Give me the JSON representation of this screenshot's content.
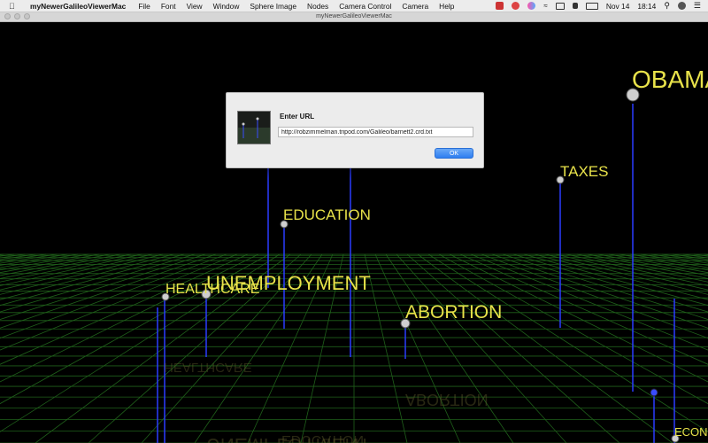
{
  "menubar": {
    "app_name": "myNewerGalileoViewerMac",
    "menus": [
      "File",
      "Font",
      "View",
      "Window",
      "Sphere Image",
      "Nodes",
      "Camera Control",
      "Camera",
      "Help"
    ],
    "date": "Nov 14",
    "time": "18:14"
  },
  "window": {
    "title": "myNewerGalileoViewerMac"
  },
  "dialog": {
    "title": "Enter URL",
    "url_value": "http://robzimmelman.tripod.com/Galileo/barnett2.crd.txt",
    "ok_label": "OK"
  },
  "scene": {
    "labels": {
      "obama": "OBAMA",
      "taxes": "TAXES",
      "education": "EDUCATION",
      "healthcare": "HEALTHCARE",
      "unemployment": "UNEMPLOYMENT",
      "abortion": "ABORTION",
      "economy": "ECON"
    }
  },
  "colors": {
    "grid": "#1f5f1a",
    "label": "#e8e24a",
    "pole": "#2a3cff",
    "accent": "#2e7ef0"
  }
}
